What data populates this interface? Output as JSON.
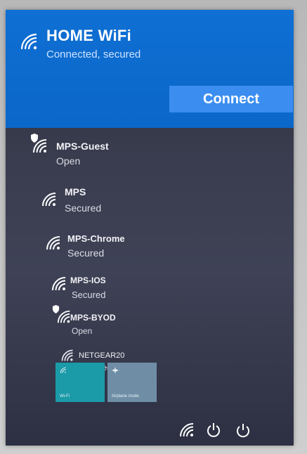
{
  "selected_network": {
    "name": "HOME WiFi",
    "status": "Connected, secured",
    "action_label": "Connect",
    "icon": "wifi-icon"
  },
  "networks": [
    {
      "name": "MPS-Guest",
      "status": "Open",
      "icon": "wifi-icon",
      "shield": true
    },
    {
      "name": "MPS",
      "status": "Secured",
      "icon": "wifi-icon",
      "shield": false
    },
    {
      "name": "MPS-Chrome",
      "status": "Secured",
      "icon": "wifi-icon",
      "shield": false
    },
    {
      "name": "MPS-IOS",
      "status": "Secured",
      "icon": "wifi-icon",
      "shield": false
    },
    {
      "name": "MPS-BYOD",
      "status": "Open",
      "icon": "wifi-icon",
      "shield": true
    },
    {
      "name": "NETGEAR20",
      "status": "Secured",
      "icon": "wifi-icon",
      "shield": false
    }
  ],
  "quick_actions": [
    {
      "label": "Wi-Fi",
      "icon": "wifi-icon",
      "active": true
    },
    {
      "label": "Airplane mode",
      "icon": "airplane-icon",
      "active": false
    }
  ],
  "tray": {
    "icons": [
      "wifi-icon",
      "power-icon",
      "power-icon"
    ]
  },
  "colors": {
    "selected_bg": "#0b67c9",
    "connect_btn": "#3b8ef0",
    "panel_bg": "#3a3d4f",
    "wifi_tile": "#1b9aa8",
    "airplane_tile": "#6f8ea6"
  }
}
